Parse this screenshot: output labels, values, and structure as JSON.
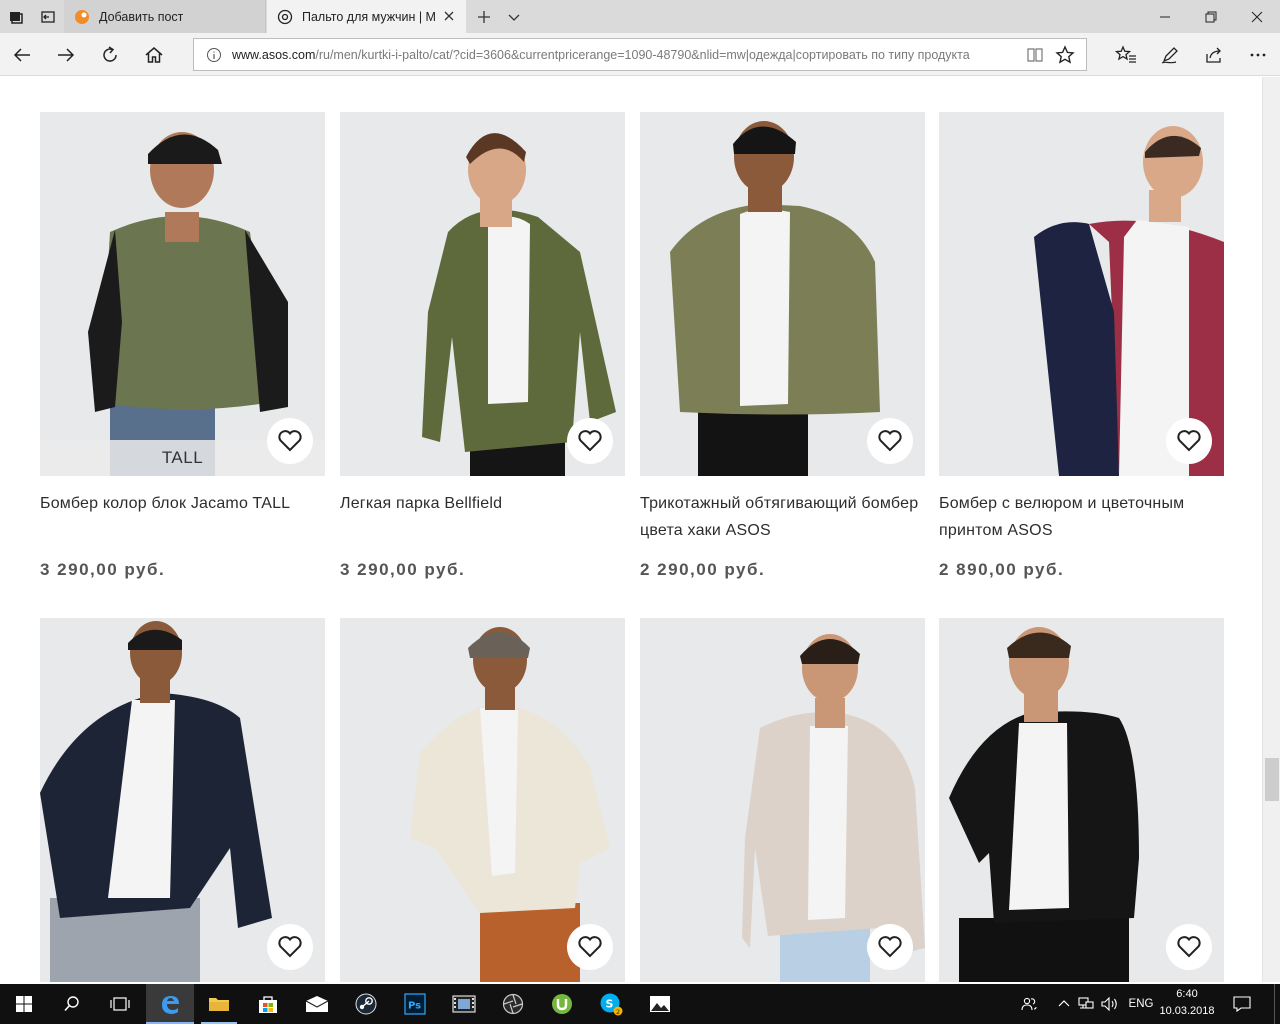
{
  "browser": {
    "tabs": [
      {
        "label": "Добавить пост",
        "state": "inactive"
      },
      {
        "label": "Пальто для мужчин | M",
        "state": "active"
      }
    ],
    "address": {
      "host": "www.asos.com",
      "path": "/ru/men/kurtki-i-palto/cat/?cid=3606&currentpricerange=1090-48790&nlid=mw|одежда|сортировать по типу продукта"
    }
  },
  "products": [
    {
      "name": "Бомбер колор блок Jacamo TALL",
      "price": "3 290,00 руб.",
      "badge": "TALL",
      "jacket_color": "#6b7650",
      "sleeve_color": "#1b1b1b"
    },
    {
      "name": "Легкая парка Bellfield",
      "price": "3 290,00 руб.",
      "badge": "",
      "jacket_color": "#5f6a3c",
      "sleeve_color": "#5f6a3c"
    },
    {
      "name": "Трикотажный обтягивающий бомбер цвета хаки ASOS",
      "price": "2 290,00 руб.",
      "badge": "",
      "jacket_color": "#7c7f55",
      "sleeve_color": "#7c7f55"
    },
    {
      "name": "Бомбер с велюром и цветочным принтом ASOS",
      "price": "2 890,00 руб.",
      "badge": "",
      "jacket_color": "#9c2f45",
      "sleeve_color": "#1d2340"
    },
    {
      "name": "",
      "price": "",
      "badge": "",
      "jacket_color": "#1d2436",
      "sleeve_color": "#1d2436"
    },
    {
      "name": "",
      "price": "",
      "badge": "",
      "jacket_color": "#ece6d8",
      "sleeve_color": "#ece6d8"
    },
    {
      "name": "",
      "price": "",
      "badge": "",
      "jacket_color": "#ddd2c9",
      "sleeve_color": "#ddd2c9"
    },
    {
      "name": "",
      "price": "",
      "badge": "",
      "jacket_color": "#151515",
      "sleeve_color": "#151515"
    }
  ],
  "taskbar": {
    "language": "ENG",
    "time": "6:40",
    "date": "10.03.2018",
    "skype_badge": "2"
  }
}
